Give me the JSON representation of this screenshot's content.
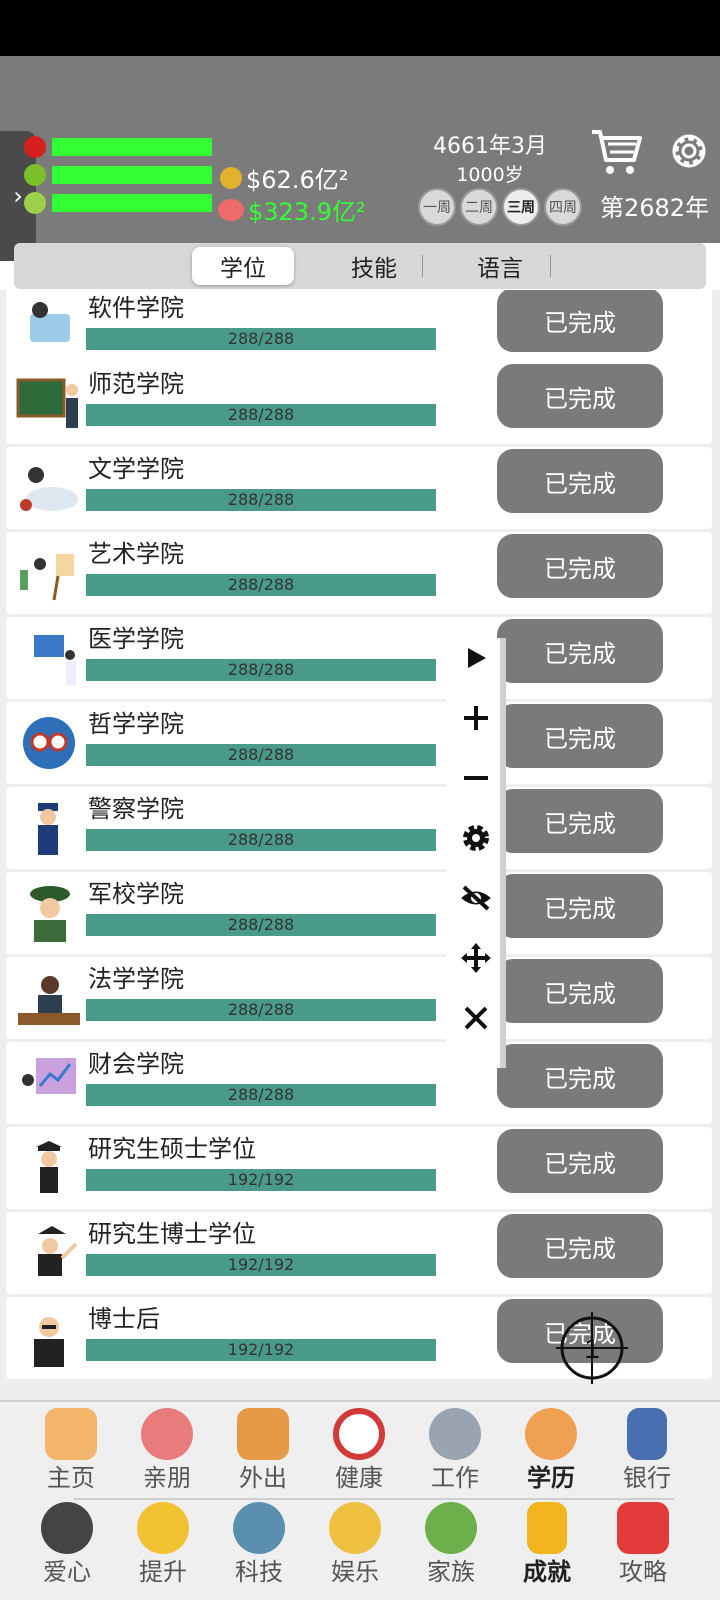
{
  "header": {
    "money": "$62.6亿²",
    "savings": "$323.9亿²",
    "date": "4661年3月",
    "age": "1000岁",
    "weeks": [
      "一周",
      "二周",
      "三周",
      "四周"
    ],
    "active_week": "三周",
    "year": "第2682年",
    "colors": {
      "bar": "#33ff33",
      "savings_text": "#33ff33"
    }
  },
  "tabs": [
    "学位",
    "技能",
    "语言"
  ],
  "rows": [
    {
      "title": "软件学院",
      "progress": "288/288",
      "button": "已完成"
    },
    {
      "title": "师范学院",
      "progress": "288/288",
      "button": "已完成"
    },
    {
      "title": "文学学院",
      "progress": "288/288",
      "button": "已完成"
    },
    {
      "title": "艺术学院",
      "progress": "288/288",
      "button": "已完成"
    },
    {
      "title": "医学学院",
      "progress": "288/288",
      "button": "已完成"
    },
    {
      "title": "哲学学院",
      "progress": "288/288",
      "button": "已完成"
    },
    {
      "title": "警察学院",
      "progress": "288/288",
      "button": "已完成"
    },
    {
      "title": "军校学院",
      "progress": "288/288",
      "button": "已完成"
    },
    {
      "title": "法学学院",
      "progress": "288/288",
      "button": "已完成"
    },
    {
      "title": "财会学院",
      "progress": "288/288",
      "button": "已完成"
    },
    {
      "title": "研究生硕士学位",
      "progress": "192/192",
      "button": "已完成"
    },
    {
      "title": "研究生博士学位",
      "progress": "192/192",
      "button": "已完成"
    },
    {
      "title": "博士后",
      "progress": "192/192",
      "button": "已完成"
    }
  ],
  "crosshair_label": "1",
  "nav": {
    "row1": [
      "主页",
      "亲朋",
      "外出",
      "健康",
      "工作",
      "学历",
      "银行"
    ],
    "row2": [
      "爱心",
      "提升",
      "科技",
      "娱乐",
      "家族",
      "成就",
      "攻略"
    ]
  }
}
